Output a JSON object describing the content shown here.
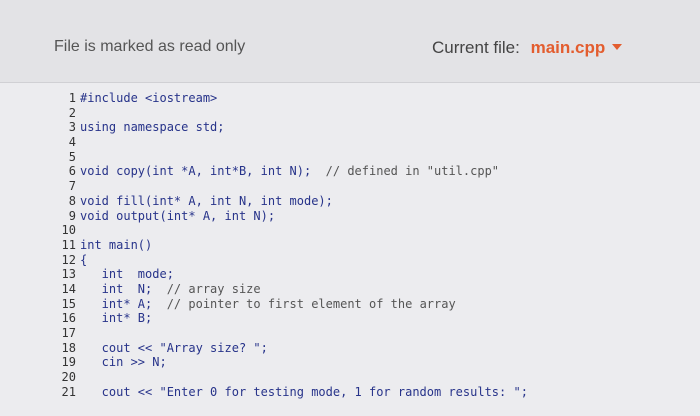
{
  "header": {
    "readonly_notice": "File is marked as read only",
    "current_file_label": "Current file:",
    "current_file_name": "main.cpp",
    "dropdown_icon": "chevron-down-icon"
  },
  "code_lines": [
    {
      "num": "1",
      "code": "#include <iostream>",
      "comment": ""
    },
    {
      "num": "2",
      "code": "",
      "comment": ""
    },
    {
      "num": "3",
      "code": "using namespace std;",
      "comment": ""
    },
    {
      "num": "4",
      "code": "",
      "comment": ""
    },
    {
      "num": "5",
      "code": "",
      "comment": ""
    },
    {
      "num": "6",
      "code": "void copy(int *A, int*B, int N);  ",
      "comment": "// defined in \"util.cpp\""
    },
    {
      "num": "7",
      "code": "",
      "comment": ""
    },
    {
      "num": "8",
      "code": "void fill(int* A, int N, int mode);",
      "comment": ""
    },
    {
      "num": "9",
      "code": "void output(int* A, int N);",
      "comment": ""
    },
    {
      "num": "10",
      "code": "",
      "comment": ""
    },
    {
      "num": "11",
      "code": "int main()",
      "comment": ""
    },
    {
      "num": "12",
      "code": "{",
      "comment": ""
    },
    {
      "num": "13",
      "code": "   int  mode;",
      "comment": ""
    },
    {
      "num": "14",
      "code": "   int  N;  ",
      "comment": "// array size"
    },
    {
      "num": "15",
      "code": "   int* A;  ",
      "comment": "// pointer to first element of the array"
    },
    {
      "num": "16",
      "code": "   int* B;",
      "comment": ""
    },
    {
      "num": "17",
      "code": "",
      "comment": ""
    },
    {
      "num": "18",
      "code": "   cout << \"Array size? \";",
      "comment": ""
    },
    {
      "num": "19",
      "code": "   cin >> N;",
      "comment": ""
    },
    {
      "num": "20",
      "code": "",
      "comment": ""
    },
    {
      "num": "21",
      "code": "   cout << \"Enter 0 for testing mode, 1 for random results: \";",
      "comment": ""
    }
  ]
}
